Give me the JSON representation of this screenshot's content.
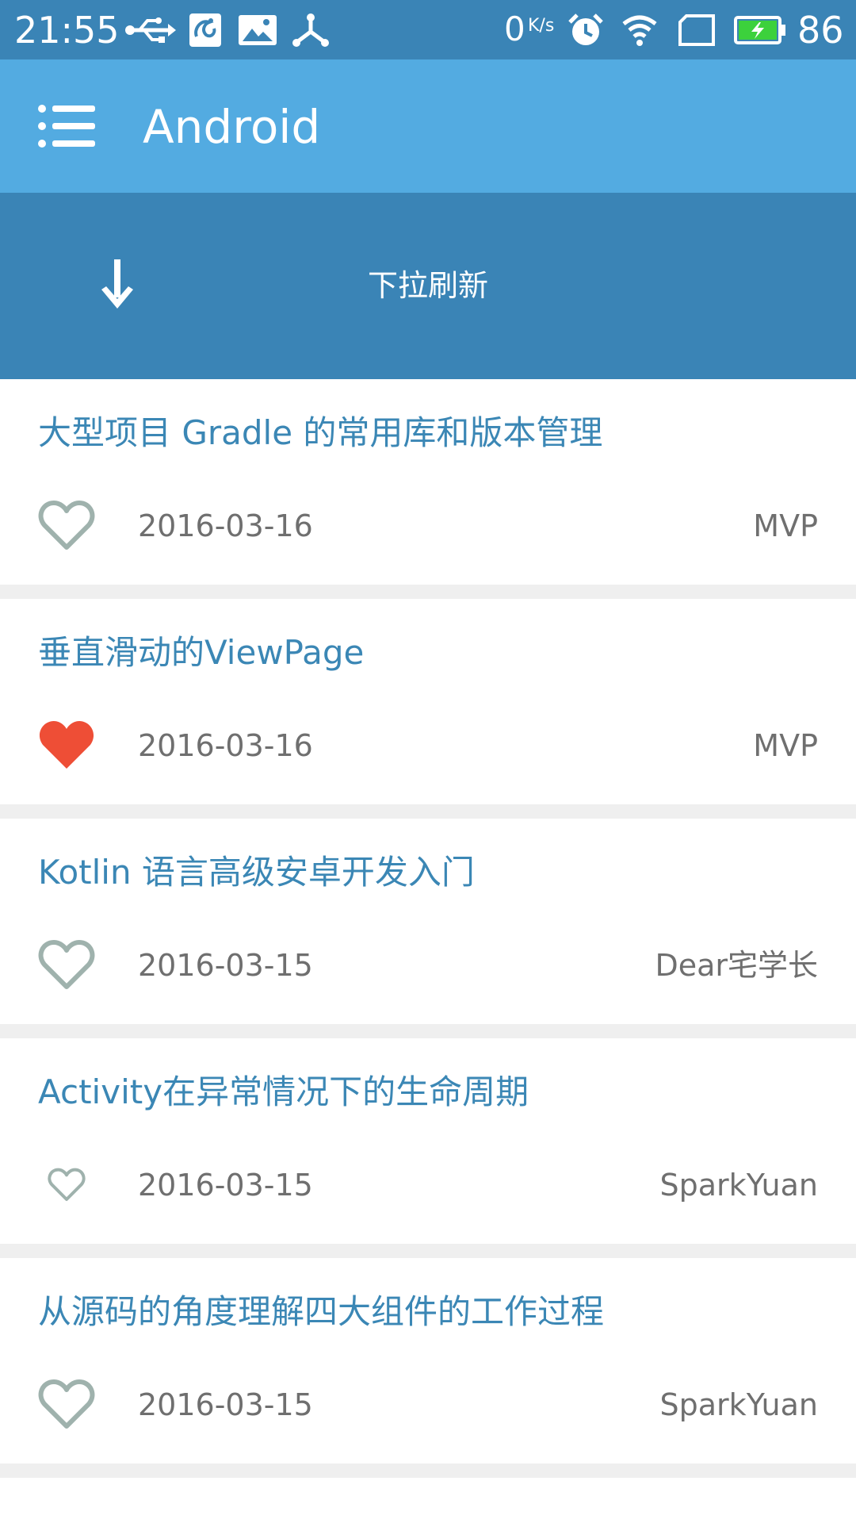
{
  "status_bar": {
    "time": "21:55",
    "net_speed": "0",
    "net_speed_unit": "K/s",
    "battery_percent": "86",
    "icons": [
      "usb-icon",
      "uc-browser-icon",
      "gallery-icon",
      "share-icon",
      "alarm-icon",
      "wifi-icon",
      "no-sim-icon",
      "battery-charging-icon"
    ]
  },
  "app_bar": {
    "title": "Android",
    "menu_icon": "menu-icon"
  },
  "refresh": {
    "label": "下拉刷新",
    "icon": "arrow-down-icon"
  },
  "colors": {
    "status_bar": "#3a84b6",
    "app_bar": "#53abe1",
    "refresh_header": "#3a84b6",
    "title_text": "#3b87b5",
    "meta_text": "#6f6f6f",
    "heart_outline": "#9fb2ad",
    "heart_filled": "#ee4e36",
    "divider": "#efefef"
  },
  "articles": [
    {
      "title": "大型项目 Gradle 的常用库和版本管理",
      "date": "2016-03-16",
      "author": "MVP",
      "liked": false
    },
    {
      "title": "垂直滑动的ViewPage",
      "date": "2016-03-16",
      "author": "MVP",
      "liked": true
    },
    {
      "title": "Kotlin 语言高级安卓开发入门",
      "date": "2016-03-15",
      "author": "Dear宅学长",
      "liked": false
    },
    {
      "title": "Activity在异常情况下的生命周期",
      "date": "2016-03-15",
      "author": "SparkYuan",
      "liked": false
    },
    {
      "title": "从源码的角度理解四大组件的工作过程",
      "date": "2016-03-15",
      "author": "SparkYuan",
      "liked": false
    }
  ]
}
